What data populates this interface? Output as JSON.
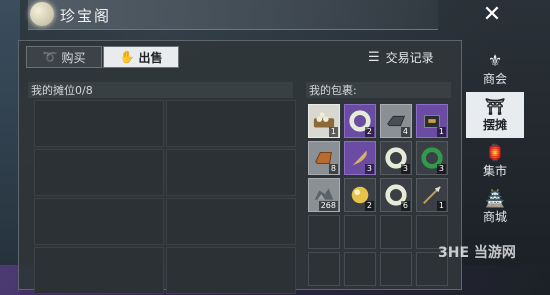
{
  "window": {
    "title": "珍宝阁",
    "close_label": "✕"
  },
  "tabs": {
    "buy_label": "购买",
    "sell_label": "出售",
    "active": "sell"
  },
  "records_label": "交易记录",
  "stall": {
    "label": "我的摊位0/8",
    "slots": 8
  },
  "bag": {
    "label": "我的包裹:",
    "items": [
      {
        "icon": "tea-tray-icon",
        "quality": "white",
        "count": "1"
      },
      {
        "icon": "jade-ring-icon",
        "quality": "purple",
        "count": "2"
      },
      {
        "icon": "iron-ingot-icon",
        "quality": "gray",
        "count": "4"
      },
      {
        "icon": "box-icon",
        "quality": "purple",
        "count": "1"
      },
      {
        "icon": "copper-ingot-icon",
        "quality": "gray",
        "count": "8"
      },
      {
        "icon": "feather-icon",
        "quality": "purple",
        "count": "3"
      },
      {
        "icon": "jade-ring-icon",
        "quality": "dark",
        "count": "3"
      },
      {
        "icon": "green-jade-ring-icon",
        "quality": "dark",
        "count": "3"
      },
      {
        "icon": "rock-icon",
        "quality": "gray",
        "count": "268"
      },
      {
        "icon": "gold-orb-icon",
        "quality": "dark",
        "count": "2"
      },
      {
        "icon": "jade-ring-icon",
        "quality": "dark",
        "count": "6"
      },
      {
        "icon": "spear-icon",
        "quality": "dark",
        "count": "1"
      },
      {
        "icon": "empty",
        "quality": "empty",
        "count": ""
      },
      {
        "icon": "empty",
        "quality": "empty",
        "count": ""
      },
      {
        "icon": "empty",
        "quality": "empty",
        "count": ""
      },
      {
        "icon": "empty",
        "quality": "empty",
        "count": ""
      },
      {
        "icon": "empty",
        "quality": "empty",
        "count": ""
      },
      {
        "icon": "empty",
        "quality": "empty",
        "count": ""
      },
      {
        "icon": "empty",
        "quality": "empty",
        "count": ""
      },
      {
        "icon": "empty",
        "quality": "empty",
        "count": ""
      }
    ]
  },
  "side_menu": [
    {
      "label": "商会",
      "icon": "guild-icon",
      "active": false
    },
    {
      "label": "摆摊",
      "icon": "stall-icon",
      "active": true
    },
    {
      "label": "集市",
      "icon": "market-icon",
      "active": false
    },
    {
      "label": "商城",
      "icon": "mall-icon",
      "active": false
    }
  ],
  "watermark": "3HE 当游网",
  "colors": {
    "panel": "#30363a",
    "active_tab": "#e9ecee",
    "purple_quality": "#6b4ca3",
    "white_quality": "#d8d8d0"
  }
}
